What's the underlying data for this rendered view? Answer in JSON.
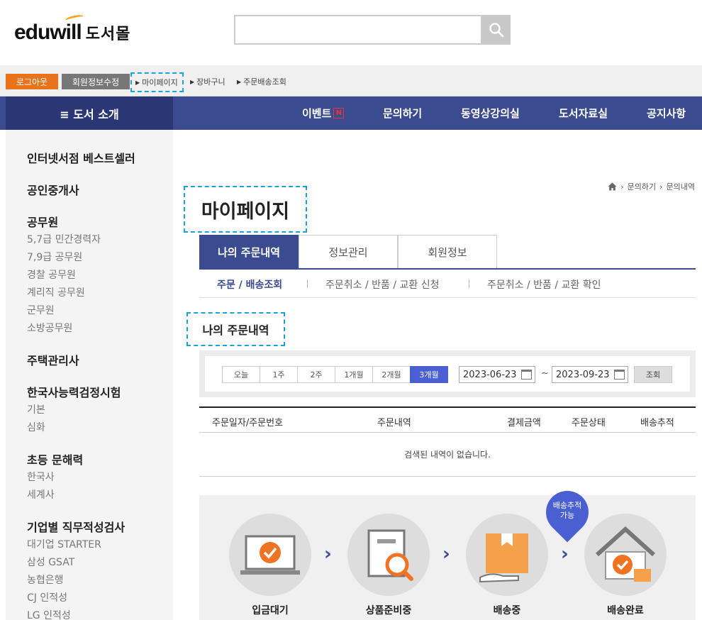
{
  "header": {
    "logo_word": "eduwill",
    "logo_sub": "도서몰",
    "search_placeholder": ""
  },
  "topbar": {
    "logout": "로그아웃",
    "edit_member": "회원정보수정",
    "links": [
      "마이페이지",
      "장바구니",
      "주문배송조회"
    ]
  },
  "nav": {
    "category": "≡ 도서 소개",
    "items": [
      "이벤트",
      "문의하기",
      "동영상강의실",
      "도서자료실",
      "공지사항"
    ],
    "event_badge": "N"
  },
  "sidebar": {
    "groups": [
      {
        "title": "인터넷서점 베스트셀러",
        "items": []
      },
      {
        "title": "공인중개사",
        "items": []
      },
      {
        "title": "공무원",
        "items": [
          "5,7급 민간경력자",
          "7,9급 공무원",
          "경찰 공무원",
          "계리직 공무원",
          "군무원",
          "소방공무원"
        ]
      },
      {
        "title": "주택관리사",
        "items": []
      },
      {
        "title": "한국사능력검정시험",
        "items": [
          "기본",
          "심화"
        ]
      },
      {
        "title": "초등 문해력",
        "items": [
          "한국사",
          "세계사"
        ]
      },
      {
        "title": "기업별 직무적성검사",
        "items": [
          "대기업 STARTER",
          "삼성 GSAT",
          "농협은행",
          "CJ 인적성",
          "LG 인적성"
        ]
      }
    ]
  },
  "breadcrumb": [
    "문의하기",
    "문의내역"
  ],
  "page_title": "마이페이지",
  "tabs": [
    "나의 주문내역",
    "정보관리",
    "회원정보"
  ],
  "subtabs": [
    "주문 / 배송조회",
    "주문취소 / 반품 / 교환 신청",
    "주문취소 / 반품 / 교환 확인"
  ],
  "section_title": "나의 주문내역",
  "filter": {
    "periods": [
      "오늘",
      "1주",
      "2주",
      "1개월",
      "2개월",
      "3개월"
    ],
    "active_period": 5,
    "date_from": "2023-06-23",
    "date_to": "2023-09-23",
    "tilde": "~",
    "search_label": "조회"
  },
  "table": {
    "headers": [
      "주문일자/주문번호",
      "주문내역",
      "결제금액",
      "주문상태",
      "배송추적"
    ],
    "empty_message": "검색된 내역이 없습니다."
  },
  "process": {
    "steps": [
      "입금대기",
      "상품준비중",
      "배송중",
      "배송완료"
    ],
    "badge_line1": "배송추적",
    "badge_line2": "가능"
  },
  "colors": {
    "nav": "#3b4b8f",
    "nav_dark": "#2b3774",
    "accent_orange": "#e8731b",
    "active_period": "#4a5fd2"
  }
}
